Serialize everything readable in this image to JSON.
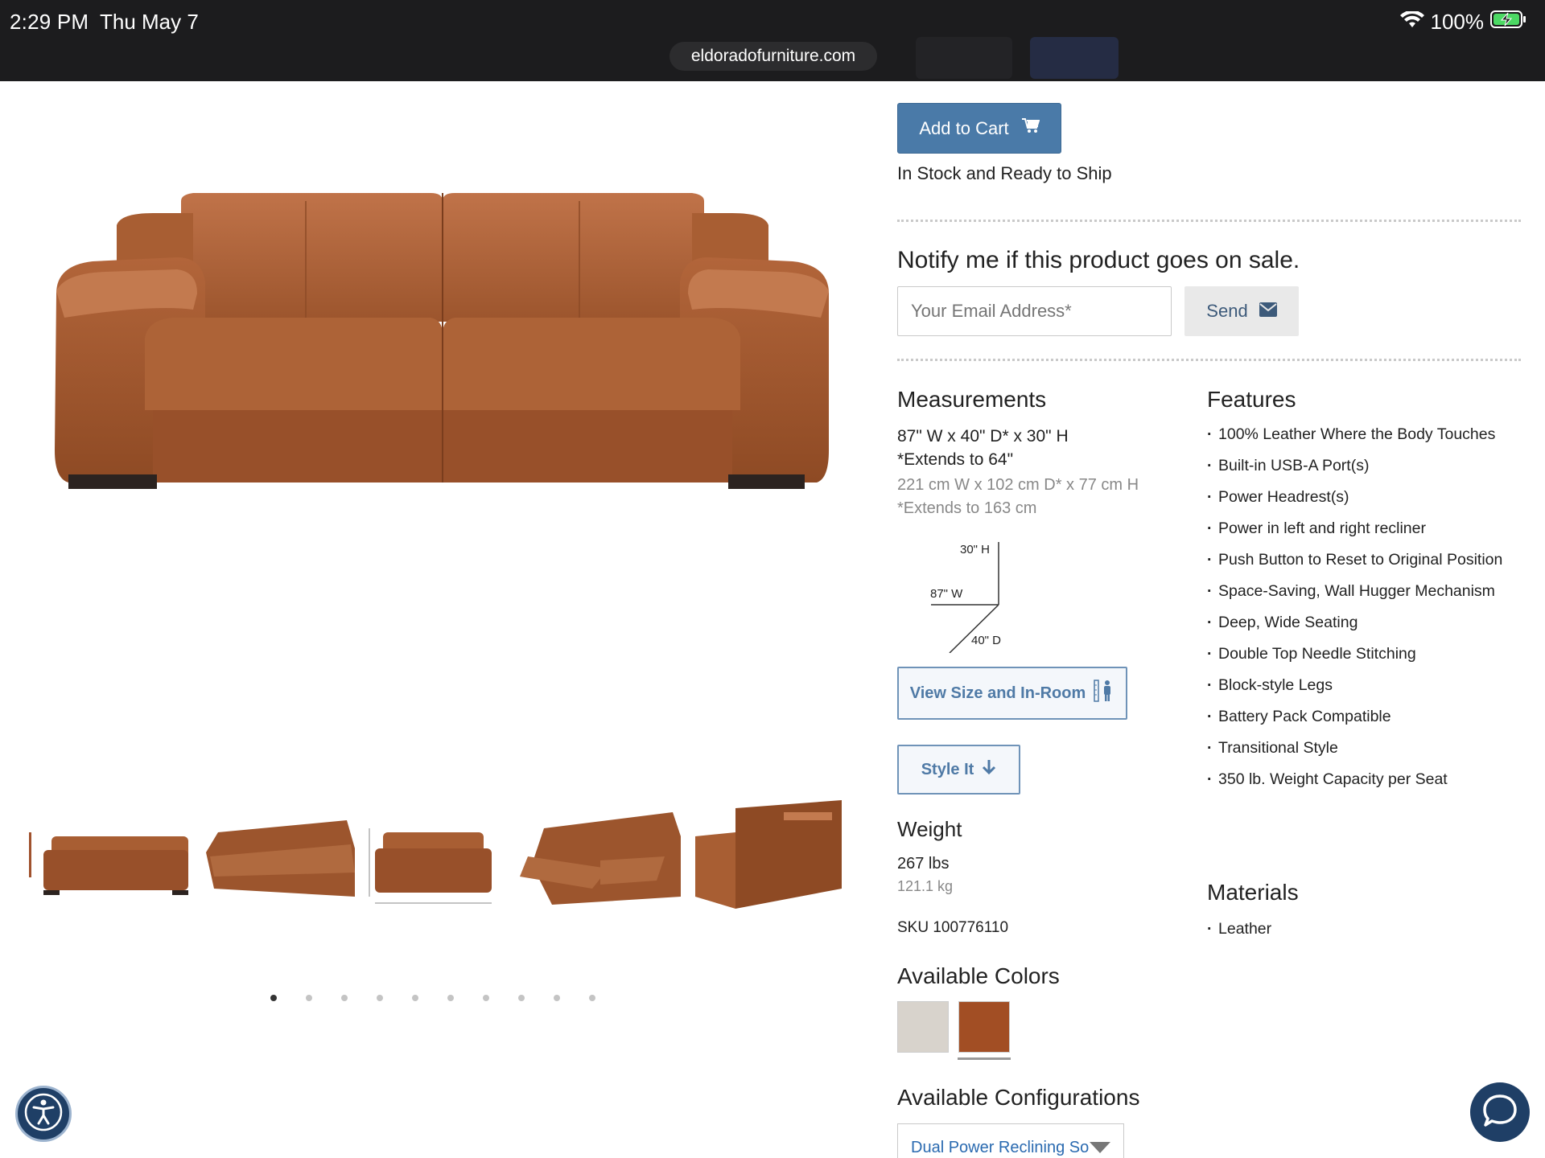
{
  "status_bar": {
    "time": "2:29 PM",
    "date": "Thu May 7",
    "battery": "100%",
    "url": "eldoradofurniture.com"
  },
  "product": {
    "add_to_cart_label": "Add to Cart",
    "stock_status": "In Stock and Ready to Ship"
  },
  "notify": {
    "heading": "Notify me if this product goes on sale.",
    "email_placeholder": "Your Email Address*",
    "send_label": "Send"
  },
  "measurements": {
    "heading": "Measurements",
    "imperial_line1": "87\" W x 40\" D* x 30\" H",
    "imperial_line2": "*Extends to 64\"",
    "metric_line1": "221 cm W x 102 cm D* x 77 cm H",
    "metric_line2": "*Extends to 163 cm",
    "diagram": {
      "height": "30\" H",
      "width": "87\" W",
      "depth": "40\" D"
    },
    "view_size_label": "View Size and In-Room",
    "style_it_label": "Style It"
  },
  "weight": {
    "heading": "Weight",
    "lbs": "267 lbs",
    "kg": "121.1 kg",
    "sku": "SKU 100776110"
  },
  "features": {
    "heading": "Features",
    "items": [
      "100% Leather Where the Body Touches",
      "Built-in USB-A Port(s)",
      "Power Headrest(s)",
      "Power in left and right recliner",
      "Push Button to Reset to Original Position",
      "Space-Saving, Wall Hugger Mechanism",
      "Deep, Wide Seating",
      "Double Top Needle Stitching",
      "Block-style Legs",
      "Battery Pack Compatible",
      "Transitional Style",
      "350 lb. Weight Capacity per Seat"
    ]
  },
  "materials": {
    "heading": "Materials",
    "items": [
      "Leather"
    ]
  },
  "colors": {
    "heading": "Available Colors",
    "swatches": [
      "#d8d3cc",
      "#a24e24"
    ]
  },
  "configurations": {
    "heading": "Available Configurations",
    "selected": "Dual Power Reclining So"
  },
  "carousel": {
    "count": 10,
    "active": 1
  }
}
